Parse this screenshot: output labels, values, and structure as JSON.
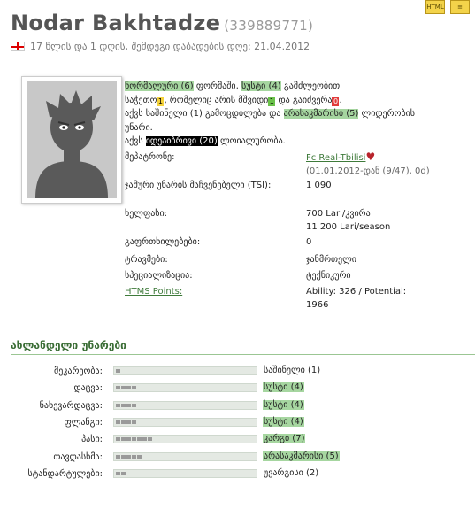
{
  "player": {
    "name": "Nodar Bakhtadze",
    "id": "(339889771)",
    "age_line": "17 წლის და 1 დღის, შემდეგი დაბადების დღე: 21.04.2012"
  },
  "toolbar": {
    "icon1": "HTML",
    "icon2": "≡"
  },
  "summary": {
    "l1a": "ნორმალური (6)",
    "l1b": " ფორმაში, ",
    "l1c": "სუსტი (4)",
    "l1d": " გამძლეობით",
    "l2a": "საჭეთო",
    "l2b": ", რომელიც არის მშვიდი",
    "l2c": " და გაიძვერა",
    "sq1": "1",
    "sq2": "1",
    "sq3": "0",
    "l3a": "აქვს საშინელი (1) გამოცდილება და ",
    "l3b": "არასაკმარისი (5)",
    "l3c": " ლიდერობის",
    "l4": "უნარი.",
    "l5a": "აქვს ",
    "l5b": "იდეაიბრივი (20)",
    "l5c": " ლოიალურობა."
  },
  "info": [
    {
      "label": "მეპატრონე:",
      "value": "Fc Real-Tbilisi",
      "extra": "(01.01.2012-დან (9/47), 0d)"
    },
    {
      "label": "ჯამური უნარის მაჩვენებელი (TSI):",
      "value": "1 090"
    },
    {
      "label": "ხელფასი:",
      "value": "700 Lari/კვირა",
      "value2": "11 200 Lari/season"
    },
    {
      "label": "გაფრთხილებები:",
      "value": "0"
    },
    {
      "label": "ტრავმები:",
      "value": "ჯანმრთელი"
    },
    {
      "label": "სპეციალიზაცია:",
      "value": "ტექნიკური"
    },
    {
      "label": "HTMS Points:",
      "value": "Ability: 326 / Potential:",
      "value2": "1966"
    }
  ],
  "skills_title": "ახლანდელი უნარები",
  "skills": [
    {
      "label": "მეკარეობა:",
      "value": "საშინელი (1)",
      "level": 1,
      "hl": false
    },
    {
      "label": "დაცვა:",
      "value": "სუსტი (4)",
      "level": 4,
      "hl": true
    },
    {
      "label": "ნახევარდაცვა:",
      "value": "სუსტი (4)",
      "level": 4,
      "hl": true
    },
    {
      "label": "ფლანგი:",
      "value": "სუსტი (4)",
      "level": 4,
      "hl": true
    },
    {
      "label": "პასი:",
      "value": "კარგი (7)",
      "level": 7,
      "hl": true
    },
    {
      "label": "თავდასხმა:",
      "value": "არასაკმარისი (5)",
      "level": 5,
      "hl": true
    },
    {
      "label": "სტანდარტულები:",
      "value": "უვარგისი (2)",
      "level": 2,
      "hl": false
    }
  ],
  "colors": {
    "accent_green": "#3a6d35",
    "highlight": "#a6d6a0"
  }
}
